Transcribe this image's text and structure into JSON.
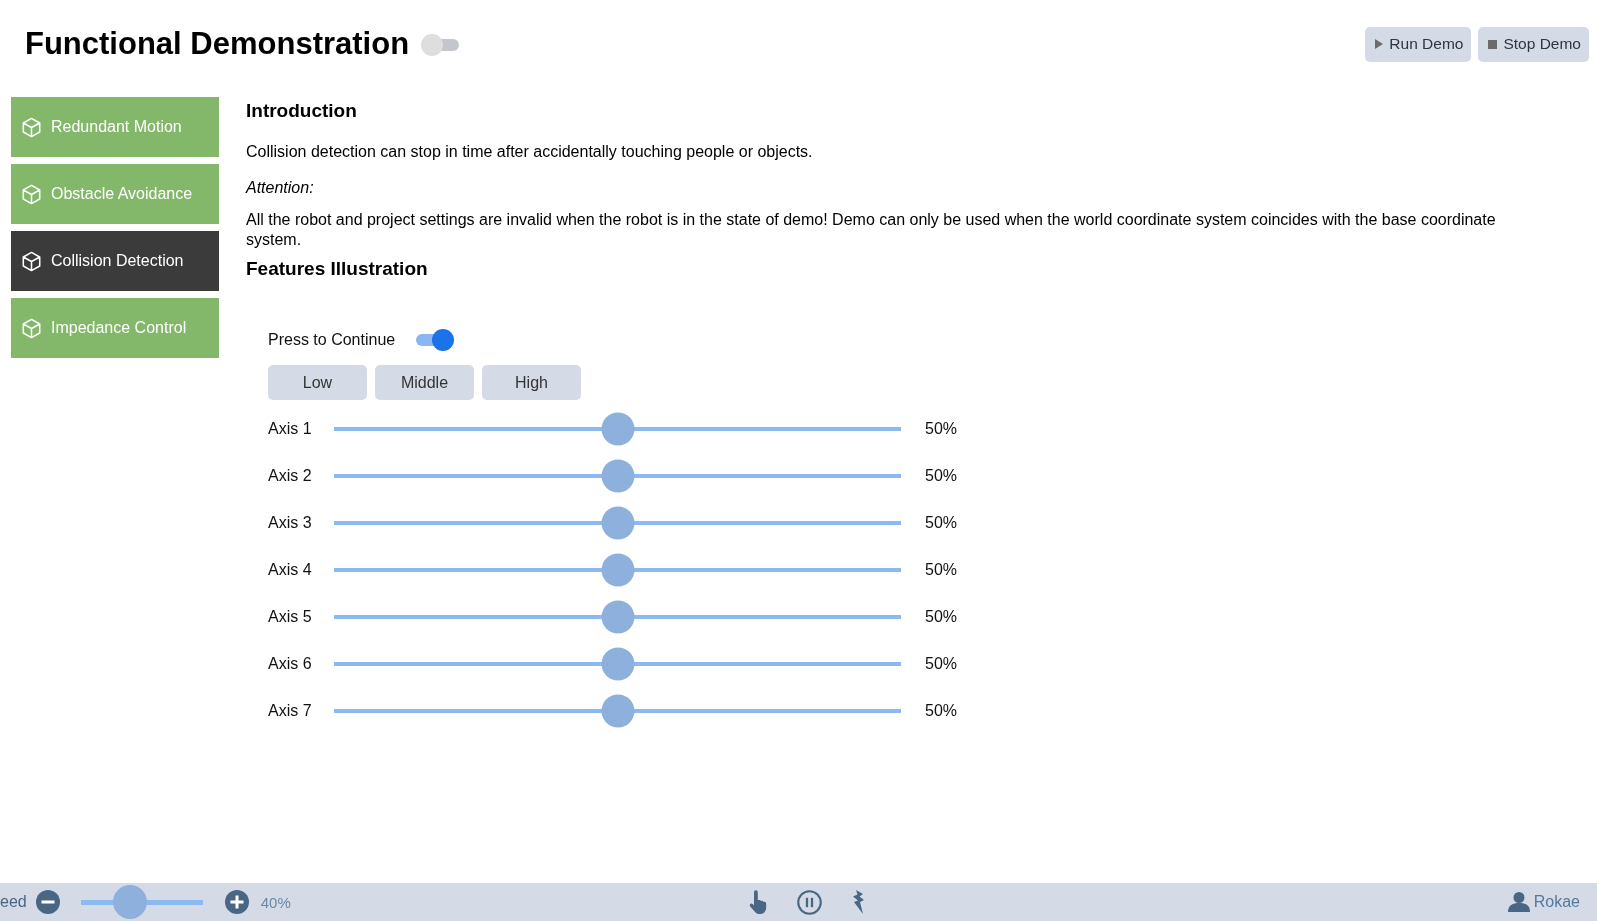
{
  "header": {
    "title": "Functional Demonstration",
    "toggle": {
      "on": false
    },
    "buttons": [
      {
        "label": "Run Demo",
        "kind": "run"
      },
      {
        "label": "Stop Demo",
        "kind": "stop"
      }
    ]
  },
  "sidebar": {
    "items": [
      {
        "label": "Redundant Motion",
        "selected": false
      },
      {
        "label": "Obstacle Avoidance",
        "selected": false
      },
      {
        "label": "Collision Detection",
        "selected": true
      },
      {
        "label": "Impedance Control",
        "selected": false
      }
    ]
  },
  "introduction": {
    "heading": "Introduction",
    "text": "Collision detection can stop in time after accidentally touching people or objects.",
    "attention_label": "Attention:",
    "attention_text": "All the robot and project settings are invalid when the robot is in the state of demo! Demo can only be used when the world coordinate system coincides with the base coordinate system."
  },
  "features": {
    "heading": "Features Illustration",
    "continue_toggle": {
      "label": "Press to Continue",
      "on": true
    },
    "buttons": [
      "Low",
      "Middle",
      "High"
    ],
    "axes": [
      {
        "name": "Axis 1",
        "level": 0.5,
        "reading": "50%"
      },
      {
        "name": "Axis 2",
        "level": 0.5,
        "reading": "50%"
      },
      {
        "name": "Axis 3",
        "level": 0.5,
        "reading": "50%"
      },
      {
        "name": "Axis 4",
        "level": 0.5,
        "reading": "50%"
      },
      {
        "name": "Axis 5",
        "level": 0.5,
        "reading": "50%"
      },
      {
        "name": "Axis 6",
        "level": 0.5,
        "reading": "50%"
      },
      {
        "name": "Axis 7",
        "level": 0.5,
        "reading": "50%"
      }
    ]
  },
  "status_bar": {
    "speed_label": "eed",
    "speed": {
      "level": 0.4,
      "reading": "40%"
    },
    "user": "Rokae"
  }
}
